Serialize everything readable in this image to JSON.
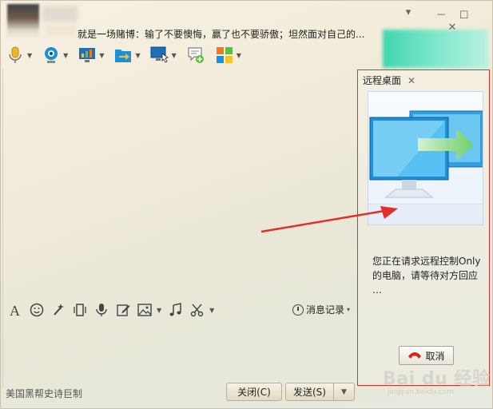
{
  "header": {
    "signature": "就是一场赌博：输了不要懊悔，赢了也不要骄傲；坦然面对自己的...",
    "minimize_icon": "▾",
    "window_icons": "－ ☐ ✕"
  },
  "panel": {
    "tab_label": "远程桌面",
    "tab_close": "✕",
    "status_line1": "您正在请求远程控制Only",
    "status_line2": "的电脑，请等待对方回应",
    "status_line3": "…",
    "cancel_label": "取消"
  },
  "chat": {
    "history_label": "消息记录",
    "history_caret": "▾",
    "footer_text": "美国黑帮史诗巨制",
    "close_button": "关闭(C)",
    "send_button": "发送(S)",
    "send_caret": "▼"
  },
  "watermark": {
    "text": "Bai du 经验",
    "sub": "jingyan.baidu.com"
  },
  "icons": {
    "toolbar": [
      "microphone-icon",
      "video-icon",
      "screen-share-icon",
      "file-transfer-icon",
      "remote-desktop-icon",
      "message-add-icon",
      "apps-icon"
    ],
    "input": [
      "font-icon",
      "emoji-icon",
      "magic-icon",
      "vibrate-icon",
      "voice-icon",
      "edit-icon",
      "image-icon",
      "music-icon",
      "screenshot-icon"
    ]
  },
  "colors": {
    "highlight_border": "#e2302c",
    "accent_blue": "#1f8fd8",
    "accent_green": "#5cc040"
  }
}
